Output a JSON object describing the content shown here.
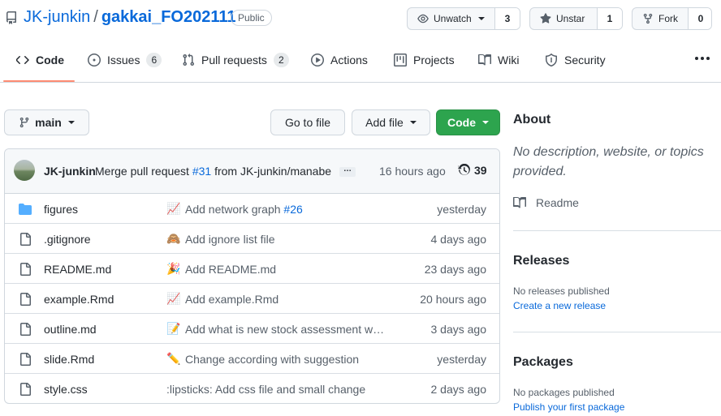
{
  "repo": {
    "owner": "JK-junkin",
    "separator": "/",
    "name": "gakkai_FO202111",
    "visibility": "Public"
  },
  "actions": {
    "watch": {
      "label": "Unwatch",
      "count": "3"
    },
    "star": {
      "label": "Unstar",
      "count": "1"
    },
    "fork": {
      "label": "Fork",
      "count": "0"
    }
  },
  "tabs": [
    {
      "label": "Code",
      "icon": "code-icon"
    },
    {
      "label": "Issues",
      "icon": "issue-icon",
      "count": "6"
    },
    {
      "label": "Pull requests",
      "icon": "pull-request-icon",
      "count": "2"
    },
    {
      "label": "Actions",
      "icon": "play-icon"
    },
    {
      "label": "Projects",
      "icon": "project-icon"
    },
    {
      "label": "Wiki",
      "icon": "book-icon"
    },
    {
      "label": "Security",
      "icon": "shield-icon"
    }
  ],
  "filenav": {
    "branch": "main",
    "go_to_file": "Go to file",
    "add_file": "Add file",
    "code": "Code"
  },
  "latest_commit": {
    "author": "JK-junkin",
    "message_prefix": "Merge pull request",
    "pr_link": "#31",
    "message_suffix": "from JK-junkin/manabe",
    "time": "16 hours ago",
    "commits": "39"
  },
  "files": [
    {
      "name": "figures",
      "type": "dir",
      "emoji": "📈",
      "message": "Add network graph",
      "link": "#26",
      "time": "yesterday"
    },
    {
      "name": ".gitignore",
      "type": "file",
      "emoji": "🙈",
      "message": "Add ignore list file",
      "time": "4 days ago"
    },
    {
      "name": "README.md",
      "type": "file",
      "emoji": "🎉",
      "message": "Add README.md",
      "time": "23 days ago"
    },
    {
      "name": "example.Rmd",
      "type": "file",
      "emoji": "📈",
      "message": "Add example.Rmd",
      "time": "20 hours ago"
    },
    {
      "name": "outline.md",
      "type": "file",
      "emoji": "📝",
      "message": "Add what is new stock assessment wor…",
      "time": "3 days ago"
    },
    {
      "name": "slide.Rmd",
      "type": "file",
      "emoji": "✏️",
      "message": "Change according with suggestion",
      "time": "yesterday"
    },
    {
      "name": "style.css",
      "type": "file",
      "emoji": "",
      "message": ":lipsticks: Add css file and small change",
      "time": "2 days ago"
    }
  ],
  "about": {
    "title": "About",
    "description": "No description, website, or topics provided.",
    "readme": "Readme"
  },
  "releases": {
    "title": "Releases",
    "empty": "No releases published",
    "link": "Create a new release"
  },
  "packages": {
    "title": "Packages",
    "empty": "No packages published",
    "link": "Publish your first package"
  },
  "colors": {
    "link": "#0969da",
    "primary_button": "#2da44e",
    "tab_underline": "#fd8c73",
    "folder": "#54aeff"
  }
}
